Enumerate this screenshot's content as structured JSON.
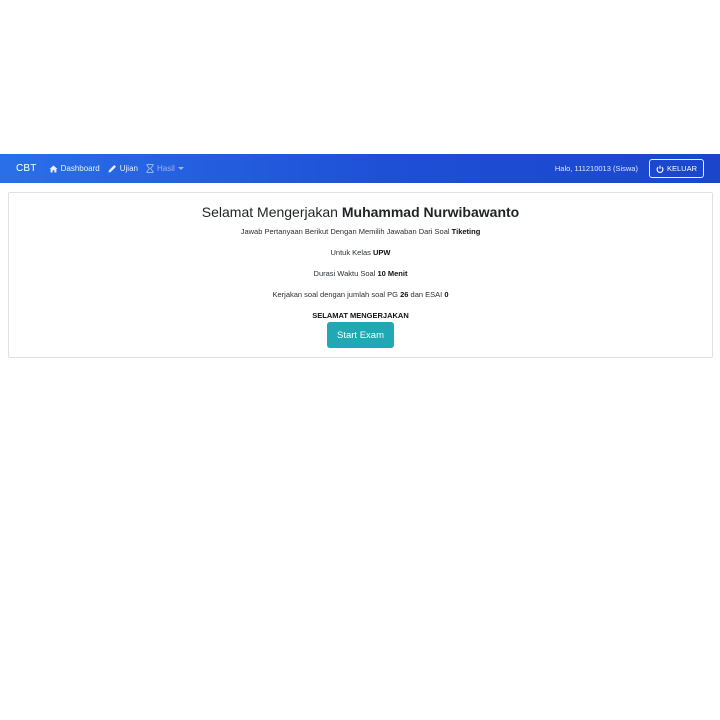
{
  "navbar": {
    "brand": "CBT",
    "items": [
      {
        "label": "Dashboard",
        "icon": "home-icon"
      },
      {
        "label": "Ujian",
        "icon": "pencil-icon"
      },
      {
        "label": "Hasil",
        "icon": "hourglass-icon"
      }
    ],
    "greeting": "Halo, 111210013 (Siswa)",
    "logout_label": "KELUAR",
    "logout_icon": "power-icon",
    "gradient_start": "#2a6fe8",
    "gradient_end": "#1b46cc"
  },
  "main": {
    "title_prefix": "Selamat Mengerjakan",
    "student_name": "Muhammad Nurwibawanto",
    "instruction_text": "Jawab Pertanyaan Berikut Dengan Memilih Jawaban Dari Soal",
    "subject": "Tiketing",
    "class_label": "Untuk Kelas",
    "class_value": "UPW",
    "duration_label": "Durasi Waktu Soal",
    "duration_value": "10 Menit",
    "count_label": "Kerjakan soal dengan jumlah soal PG",
    "pg_count": "26",
    "essay_label": "dan ESAI",
    "essay_count": "0",
    "closing": "SELAMAT MENGERJAKAN",
    "start_button": "Start Exam",
    "button_color": "#20a8b4"
  }
}
